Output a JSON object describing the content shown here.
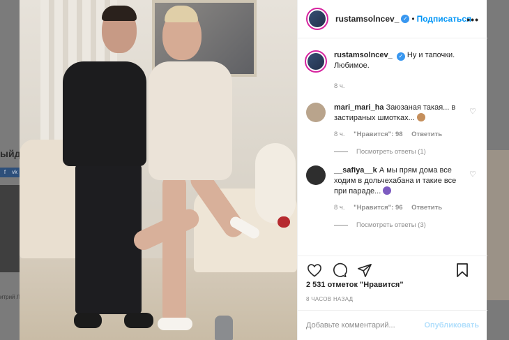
{
  "background": {
    "left_text": "ыйде",
    "social_icons": [
      "f",
      "vk"
    ],
    "left_caption": "итрий Л... Влади"
  },
  "post": {
    "author": "rustamsolncev_",
    "follow_label": "Подписаться",
    "more_label": "•••",
    "caption": "Ну и тапочки. Любимое.",
    "caption_time": "8 ч."
  },
  "comments": [
    {
      "user": "mari_mari_ha",
      "text": "Заюзаная такая... в застираных шмотках...",
      "time": "8 ч.",
      "likes": "\"Нравится\": 98",
      "reply": "Ответить",
      "view_replies": "Посмотреть ответы (1)",
      "avatar_color": "#b9a48c",
      "emoji_color": "#c58f5c"
    },
    {
      "user": "__safiya__k",
      "text": "А мы прям дома все ходим в дольчехабана и такие все при параде...",
      "time": "8 ч.",
      "likes": "\"Нравится\": 96",
      "reply": "Ответить",
      "view_replies": "Посмотреть ответы (3)",
      "avatar_color": "#2e2e2e",
      "emoji_color": "#7d5cc0"
    }
  ],
  "footer": {
    "likes": "2 531 отметок \"Нравится\"",
    "timestamp": "8 ЧАСОВ НАЗАД",
    "comment_placeholder": "Добавьте комментарий...",
    "publish_label": "Опубликовать"
  },
  "colors": {
    "accent": "#0095f6",
    "verified": "#3897f0",
    "muted": "#8e8e8e"
  }
}
